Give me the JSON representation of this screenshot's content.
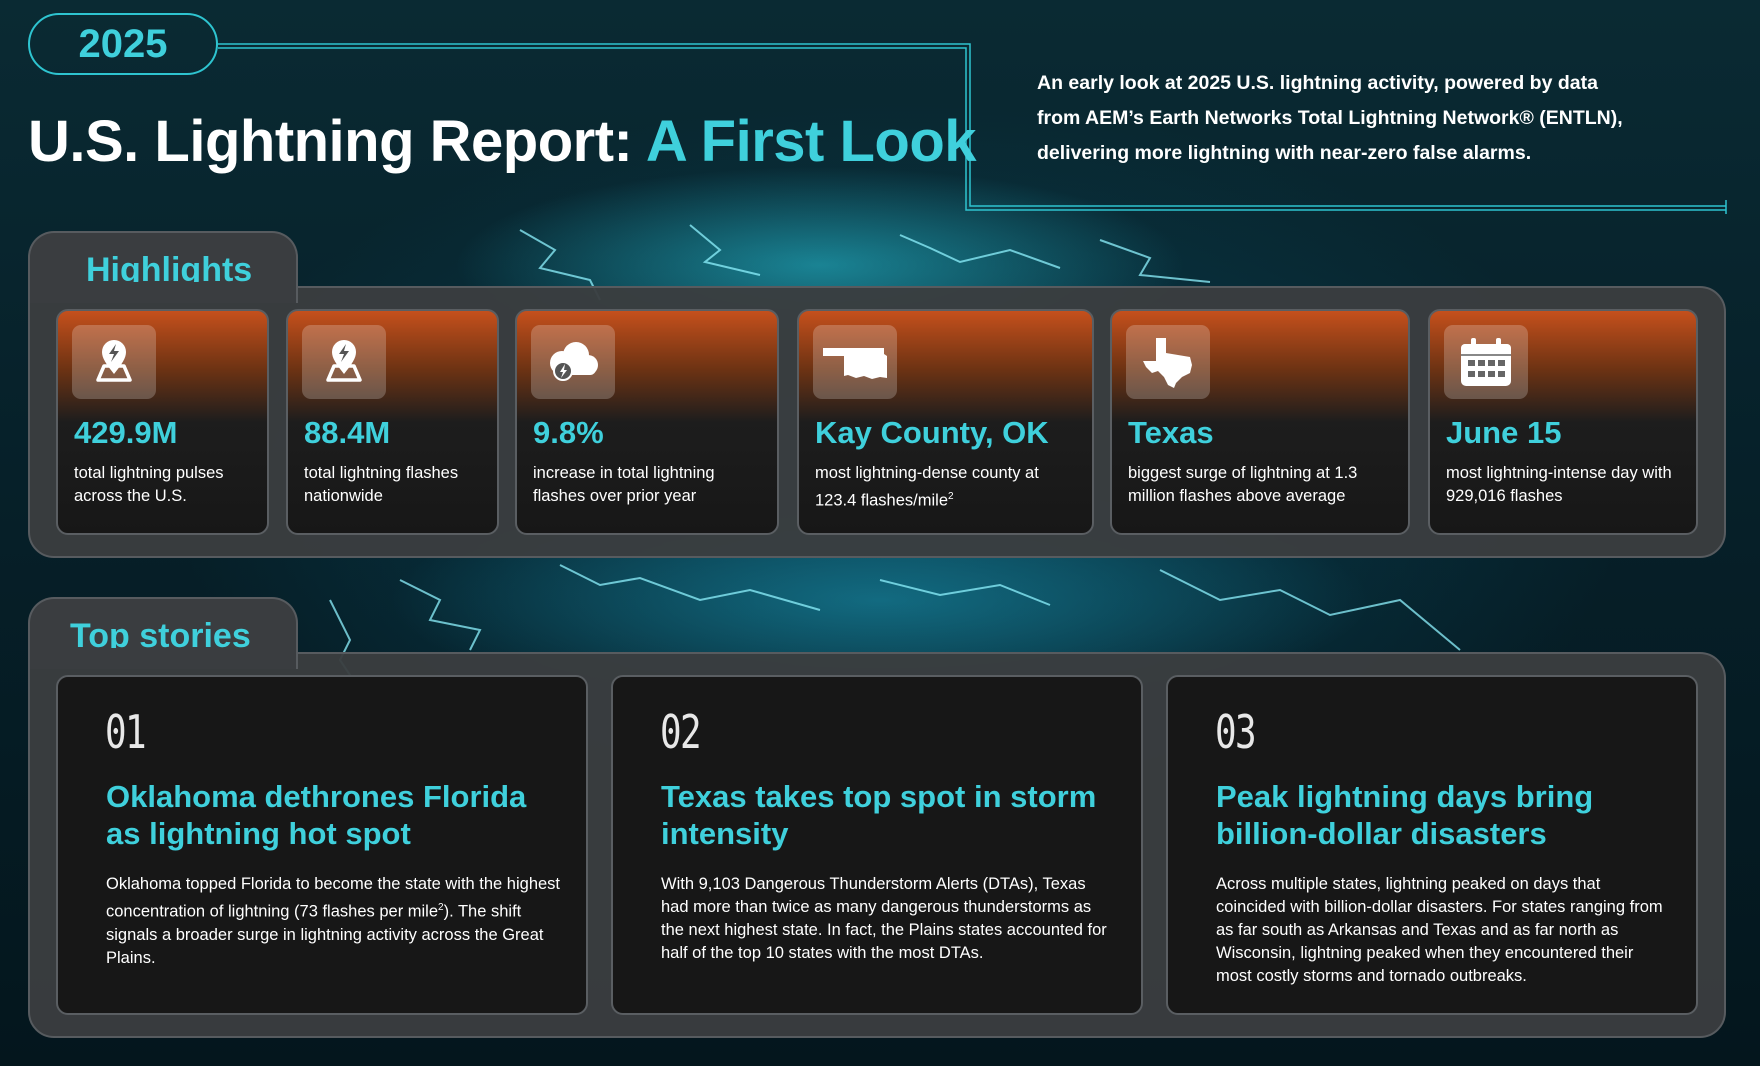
{
  "header": {
    "year": "2025",
    "title_main": "U.S. Lightning Report: ",
    "title_accent": "A First Look",
    "intro": "An early look at 2025 U.S. lightning activity, powered by data from AEM’s Earth Networks Total Lightning Network® (ENTLN), delivering more lightning with near-zero false alarms."
  },
  "highlights": {
    "heading": "Highlights",
    "cards": [
      {
        "icon": "map-lightning-pin-icon",
        "value": "429.9M",
        "desc": "total lightning pulses across the U.S."
      },
      {
        "icon": "map-lightning-pin-icon",
        "value": "88.4M",
        "desc": "total lightning flashes nationwide"
      },
      {
        "icon": "storm-cloud-icon",
        "value": "9.8%",
        "desc": "increase in total lightning flashes over prior year"
      },
      {
        "icon": "oklahoma-map-icon",
        "value": "Kay County, OK",
        "desc": "most lightning-dense county at 123.4 flashes/mile",
        "desc_sup": "2"
      },
      {
        "icon": "texas-map-icon",
        "value": "Texas",
        "desc": "biggest surge of lightning at 1.3 million flashes above average"
      },
      {
        "icon": "calendar-icon",
        "value": "June 15",
        "desc": "most lightning-intense day with 929,016 flashes"
      }
    ]
  },
  "stories": {
    "heading": "Top stories",
    "items": [
      {
        "num": "01",
        "headline": "Oklahoma dethrones Florida as lightning hot spot",
        "body_pre": "Oklahoma topped Florida to become the state with the highest concentration of lightning (73 flashes per mile",
        "body_sup": "2",
        "body_post": "). The shift signals a broader surge in lightning activity across the Great Plains."
      },
      {
        "num": "02",
        "headline": "Texas takes top spot in storm intensity",
        "body": "With 9,103 Dangerous Thunderstorm Alerts (DTAs), Texas had more than twice as many dangerous thunderstorms as the next highest state. In fact, the Plains states accounted for half of the top 10 states with the most DTAs."
      },
      {
        "num": "03",
        "headline": "Peak lightning days bring billion-dollar disasters",
        "body": "Across multiple states, lightning peaked on days that coincided with billion-dollar disasters. For states ranging from as far south as Arkansas and Texas and as far north as Wisconsin, lightning peaked when they encountered their most costly storms and tornado outbreaks."
      }
    ]
  },
  "colors": {
    "accent": "#3fd0dc",
    "card_top": "#c5501c",
    "panel": "#3a3d40",
    "background": "#062029"
  }
}
